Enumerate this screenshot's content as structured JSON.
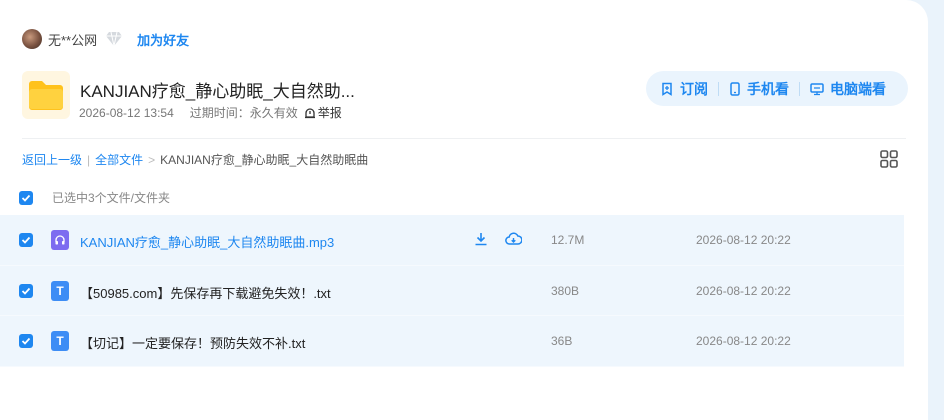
{
  "share": {
    "user_name": "无**公网",
    "add_friend": "加为好友"
  },
  "folder": {
    "title": "KANJIAN疗愈_静心助眠_大自然助...",
    "created": "2026-08-12 13:54",
    "expire": "过期时间：永久有效",
    "report": "举报"
  },
  "actions": {
    "subscribe": "订阅",
    "mobile": "手机看",
    "desktop": "电脑端看"
  },
  "breadcrumb": {
    "back": "返回上一级",
    "all_files": "全部文件",
    "separator": ">",
    "current": "KANJIAN疗愈_静心助眠_大自然助眠曲"
  },
  "selection": {
    "text": "已选中3个文件/文件夹"
  },
  "files": [
    {
      "name": "KANJIAN疗愈_静心助眠_大自然助眠曲.mp3",
      "size": "12.7M",
      "date": "2026-08-12 20:22",
      "type": "audio-icon"
    },
    {
      "name": "【50985.com】先保存再下载避免失效！.txt",
      "size": "380B",
      "date": "2026-08-12 20:22",
      "type": "text-file-icon"
    },
    {
      "name": "【切记】一定要保存！预防失效不补.txt",
      "size": "36B",
      "date": "2026-08-12 20:22",
      "type": "text-file-icon"
    }
  ],
  "file_icon_letter": "T",
  "colors": {
    "accent": "#1e87f0",
    "row_highlight": "#eef6fd",
    "audio_icon": "#7d6cf0",
    "text_icon": "#3d8df5",
    "folder": "#ffc21c"
  }
}
